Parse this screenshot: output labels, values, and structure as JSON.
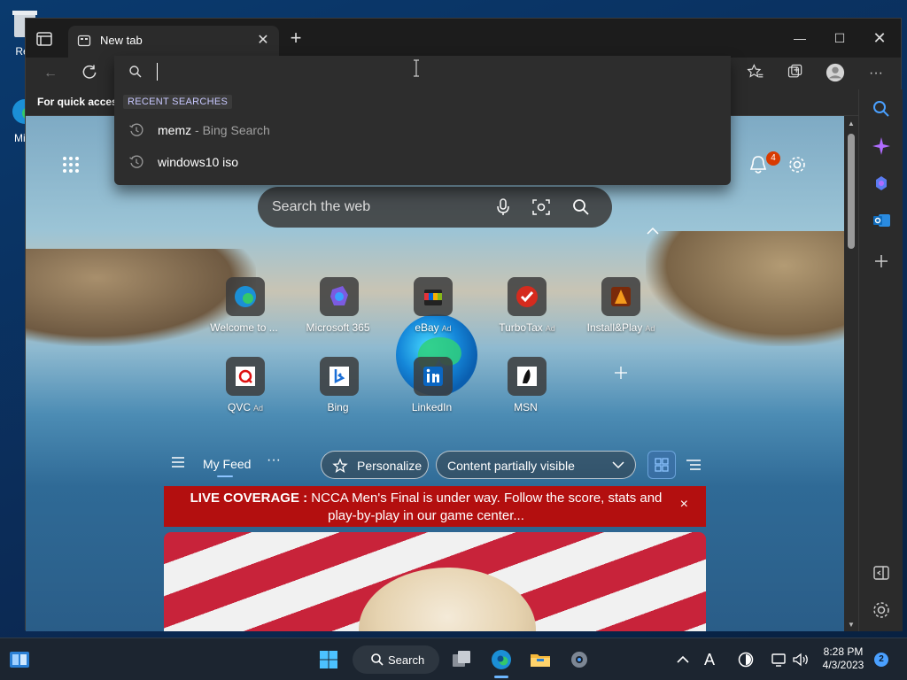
{
  "desktop": {
    "icons": [
      {
        "label": "Rec"
      },
      {
        "label": "Mi E"
      }
    ]
  },
  "browser": {
    "tab": {
      "title": "New tab"
    },
    "favorites_bar": {
      "text": "For quick access"
    },
    "omnibox": {
      "header": "RECENT SEARCHES",
      "suggestions": [
        {
          "query": "memz",
          "source": " - Bing Search"
        },
        {
          "query": "windows10 iso",
          "source": ""
        }
      ]
    },
    "notifications": {
      "count": "4"
    }
  },
  "newtab": {
    "search": {
      "placeholder": "Search the web"
    },
    "quick_links": [
      {
        "label": "Welcome to ...",
        "ad": "",
        "icon": "edge-icon"
      },
      {
        "label": "Microsoft 365",
        "ad": "",
        "icon": "m365-icon"
      },
      {
        "label": "eBay",
        "ad": "Ad",
        "icon": "ebay-icon"
      },
      {
        "label": "TurboTax",
        "ad": "Ad",
        "icon": "turbotax-icon"
      },
      {
        "label": "Install&Play",
        "ad": "Ad",
        "icon": "game-icon"
      },
      {
        "label": "QVC",
        "ad": "Ad",
        "icon": "qvc-icon"
      },
      {
        "label": "Bing",
        "ad": "",
        "icon": "bing-icon"
      },
      {
        "label": "LinkedIn",
        "ad": "",
        "icon": "linkedin-icon"
      },
      {
        "label": "MSN",
        "ad": "",
        "icon": "msn-icon"
      }
    ],
    "feed": {
      "my_feed": "My Feed",
      "more": "···",
      "personalize": "Personalize",
      "content_visibility": "Content partially visible"
    },
    "banner": {
      "bold": "LIVE COVERAGE :",
      "text": " NCCA Men's Final is under way. Follow the score, stats and play-by-play in our game center...",
      "close": "×"
    }
  },
  "taskbar": {
    "search_label": "Search",
    "time": "8:28 PM",
    "date": "4/3/2023",
    "notification_count": "2",
    "input_indicator": "A"
  },
  "colors": {
    "banner_red": "#b30f0f",
    "accent_blue": "#4aa0ff",
    "notification_orange": "#d83b01"
  }
}
